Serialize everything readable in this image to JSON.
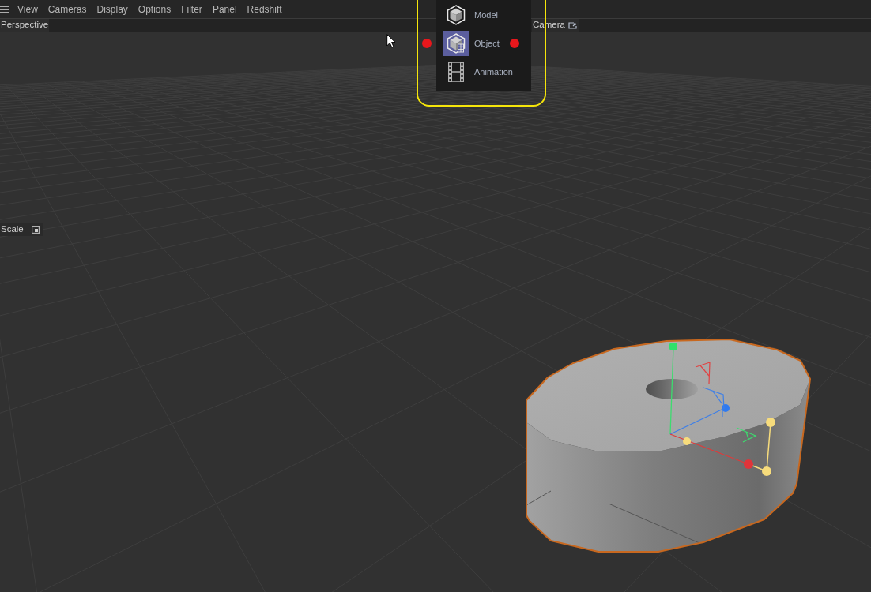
{
  "menu_bar": {
    "items": [
      "View",
      "Cameras",
      "Display",
      "Options",
      "Filter",
      "Panel",
      "Redshift"
    ]
  },
  "viewport": {
    "view_label": "Perspective",
    "camera_button": "Camera",
    "scale_button": "Scale"
  },
  "popup_menu": {
    "items": [
      {
        "label": "Model",
        "kind": "model",
        "selected": false
      },
      {
        "label": "Object",
        "kind": "object",
        "selected": true
      },
      {
        "label": "Animation",
        "kind": "animation",
        "selected": false
      }
    ]
  }
}
